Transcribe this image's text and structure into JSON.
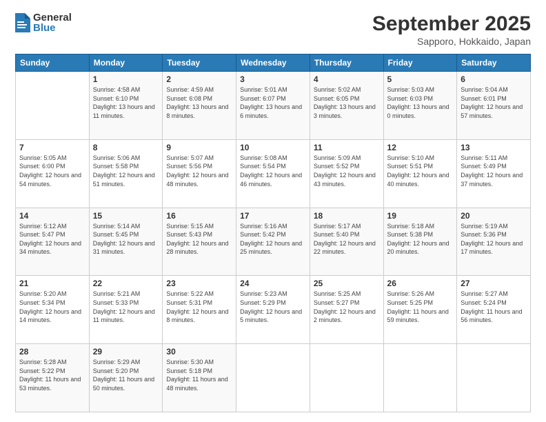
{
  "logo": {
    "general": "General",
    "blue": "Blue"
  },
  "header": {
    "month": "September 2025",
    "location": "Sapporo, Hokkaido, Japan"
  },
  "weekdays": [
    "Sunday",
    "Monday",
    "Tuesday",
    "Wednesday",
    "Thursday",
    "Friday",
    "Saturday"
  ],
  "weeks": [
    [
      {
        "day": "",
        "sunrise": "",
        "sunset": "",
        "daylight": ""
      },
      {
        "day": "1",
        "sunrise": "Sunrise: 4:58 AM",
        "sunset": "Sunset: 6:10 PM",
        "daylight": "Daylight: 13 hours and 11 minutes."
      },
      {
        "day": "2",
        "sunrise": "Sunrise: 4:59 AM",
        "sunset": "Sunset: 6:08 PM",
        "daylight": "Daylight: 13 hours and 8 minutes."
      },
      {
        "day": "3",
        "sunrise": "Sunrise: 5:01 AM",
        "sunset": "Sunset: 6:07 PM",
        "daylight": "Daylight: 13 hours and 6 minutes."
      },
      {
        "day": "4",
        "sunrise": "Sunrise: 5:02 AM",
        "sunset": "Sunset: 6:05 PM",
        "daylight": "Daylight: 13 hours and 3 minutes."
      },
      {
        "day": "5",
        "sunrise": "Sunrise: 5:03 AM",
        "sunset": "Sunset: 6:03 PM",
        "daylight": "Daylight: 13 hours and 0 minutes."
      },
      {
        "day": "6",
        "sunrise": "Sunrise: 5:04 AM",
        "sunset": "Sunset: 6:01 PM",
        "daylight": "Daylight: 12 hours and 57 minutes."
      }
    ],
    [
      {
        "day": "7",
        "sunrise": "Sunrise: 5:05 AM",
        "sunset": "Sunset: 6:00 PM",
        "daylight": "Daylight: 12 hours and 54 minutes."
      },
      {
        "day": "8",
        "sunrise": "Sunrise: 5:06 AM",
        "sunset": "Sunset: 5:58 PM",
        "daylight": "Daylight: 12 hours and 51 minutes."
      },
      {
        "day": "9",
        "sunrise": "Sunrise: 5:07 AM",
        "sunset": "Sunset: 5:56 PM",
        "daylight": "Daylight: 12 hours and 48 minutes."
      },
      {
        "day": "10",
        "sunrise": "Sunrise: 5:08 AM",
        "sunset": "Sunset: 5:54 PM",
        "daylight": "Daylight: 12 hours and 46 minutes."
      },
      {
        "day": "11",
        "sunrise": "Sunrise: 5:09 AM",
        "sunset": "Sunset: 5:52 PM",
        "daylight": "Daylight: 12 hours and 43 minutes."
      },
      {
        "day": "12",
        "sunrise": "Sunrise: 5:10 AM",
        "sunset": "Sunset: 5:51 PM",
        "daylight": "Daylight: 12 hours and 40 minutes."
      },
      {
        "day": "13",
        "sunrise": "Sunrise: 5:11 AM",
        "sunset": "Sunset: 5:49 PM",
        "daylight": "Daylight: 12 hours and 37 minutes."
      }
    ],
    [
      {
        "day": "14",
        "sunrise": "Sunrise: 5:12 AM",
        "sunset": "Sunset: 5:47 PM",
        "daylight": "Daylight: 12 hours and 34 minutes."
      },
      {
        "day": "15",
        "sunrise": "Sunrise: 5:14 AM",
        "sunset": "Sunset: 5:45 PM",
        "daylight": "Daylight: 12 hours and 31 minutes."
      },
      {
        "day": "16",
        "sunrise": "Sunrise: 5:15 AM",
        "sunset": "Sunset: 5:43 PM",
        "daylight": "Daylight: 12 hours and 28 minutes."
      },
      {
        "day": "17",
        "sunrise": "Sunrise: 5:16 AM",
        "sunset": "Sunset: 5:42 PM",
        "daylight": "Daylight: 12 hours and 25 minutes."
      },
      {
        "day": "18",
        "sunrise": "Sunrise: 5:17 AM",
        "sunset": "Sunset: 5:40 PM",
        "daylight": "Daylight: 12 hours and 22 minutes."
      },
      {
        "day": "19",
        "sunrise": "Sunrise: 5:18 AM",
        "sunset": "Sunset: 5:38 PM",
        "daylight": "Daylight: 12 hours and 20 minutes."
      },
      {
        "day": "20",
        "sunrise": "Sunrise: 5:19 AM",
        "sunset": "Sunset: 5:36 PM",
        "daylight": "Daylight: 12 hours and 17 minutes."
      }
    ],
    [
      {
        "day": "21",
        "sunrise": "Sunrise: 5:20 AM",
        "sunset": "Sunset: 5:34 PM",
        "daylight": "Daylight: 12 hours and 14 minutes."
      },
      {
        "day": "22",
        "sunrise": "Sunrise: 5:21 AM",
        "sunset": "Sunset: 5:33 PM",
        "daylight": "Daylight: 12 hours and 11 minutes."
      },
      {
        "day": "23",
        "sunrise": "Sunrise: 5:22 AM",
        "sunset": "Sunset: 5:31 PM",
        "daylight": "Daylight: 12 hours and 8 minutes."
      },
      {
        "day": "24",
        "sunrise": "Sunrise: 5:23 AM",
        "sunset": "Sunset: 5:29 PM",
        "daylight": "Daylight: 12 hours and 5 minutes."
      },
      {
        "day": "25",
        "sunrise": "Sunrise: 5:25 AM",
        "sunset": "Sunset: 5:27 PM",
        "daylight": "Daylight: 12 hours and 2 minutes."
      },
      {
        "day": "26",
        "sunrise": "Sunrise: 5:26 AM",
        "sunset": "Sunset: 5:25 PM",
        "daylight": "Daylight: 11 hours and 59 minutes."
      },
      {
        "day": "27",
        "sunrise": "Sunrise: 5:27 AM",
        "sunset": "Sunset: 5:24 PM",
        "daylight": "Daylight: 11 hours and 56 minutes."
      }
    ],
    [
      {
        "day": "28",
        "sunrise": "Sunrise: 5:28 AM",
        "sunset": "Sunset: 5:22 PM",
        "daylight": "Daylight: 11 hours and 53 minutes."
      },
      {
        "day": "29",
        "sunrise": "Sunrise: 5:29 AM",
        "sunset": "Sunset: 5:20 PM",
        "daylight": "Daylight: 11 hours and 50 minutes."
      },
      {
        "day": "30",
        "sunrise": "Sunrise: 5:30 AM",
        "sunset": "Sunset: 5:18 PM",
        "daylight": "Daylight: 11 hours and 48 minutes."
      },
      {
        "day": "",
        "sunrise": "",
        "sunset": "",
        "daylight": ""
      },
      {
        "day": "",
        "sunrise": "",
        "sunset": "",
        "daylight": ""
      },
      {
        "day": "",
        "sunrise": "",
        "sunset": "",
        "daylight": ""
      },
      {
        "day": "",
        "sunrise": "",
        "sunset": "",
        "daylight": ""
      }
    ]
  ]
}
